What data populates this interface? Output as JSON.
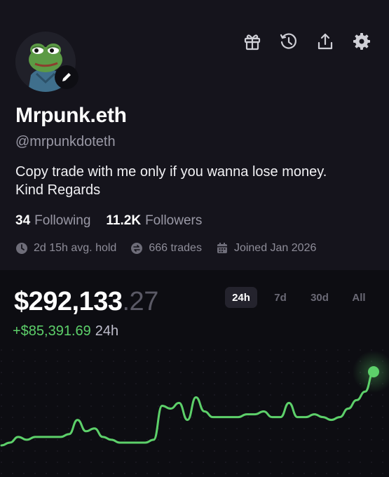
{
  "profile": {
    "name": "Mrpunk.eth",
    "handle": "@mrpunkdoteth",
    "bio_line1": "Copy trade with me only if you wanna lose money.",
    "bio_line2": "Kind Regards",
    "following_count": "34",
    "following_label": "Following",
    "followers_count": "11.2K",
    "followers_label": "Followers",
    "avg_hold": "2d 15h avg. hold",
    "trades": "666 trades",
    "joined": "Joined Jan 2026"
  },
  "toolbar_icons": [
    "gift-icon",
    "history-icon",
    "share-icon",
    "settings-icon"
  ],
  "portfolio": {
    "value_main": "$292,133",
    "value_decimal": ".27",
    "change_amount": "+$85,391.69",
    "change_period": "24h"
  },
  "ranges": [
    {
      "label": "24h",
      "active": true
    },
    {
      "label": "7d",
      "active": false
    },
    {
      "label": "30d",
      "active": false
    },
    {
      "label": "All",
      "active": false
    }
  ],
  "chart_data": {
    "type": "line",
    "series": [
      {
        "values": [
          0,
          1,
          3,
          2,
          3,
          3,
          3,
          3,
          4,
          9,
          5,
          6,
          3,
          2,
          1,
          1,
          1,
          1,
          2,
          14,
          13,
          15,
          9,
          17,
          12,
          10,
          10,
          10,
          10,
          11,
          11,
          12,
          10,
          10,
          15,
          10,
          10,
          11,
          10,
          9,
          10,
          13,
          16,
          19,
          26
        ]
      }
    ],
    "grid": "dotted"
  },
  "colors": {
    "accent_green": "#5dd06a",
    "profile_bg": "#15141c",
    "page_bg": "#0d0d12"
  }
}
